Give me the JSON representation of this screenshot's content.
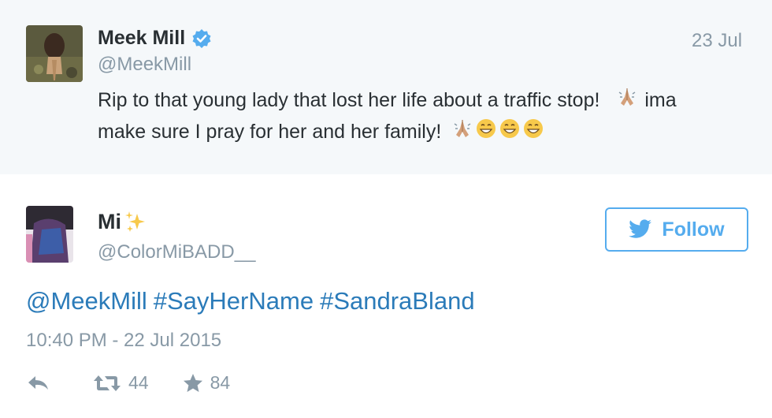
{
  "quoted_tweet": {
    "name": "Meek Mill",
    "handle": "@MeekMill",
    "date": "23 Jul",
    "text_line1": "Rip to that young lady that lost her life about a traffic stop!",
    "text_line1_after": "ima",
    "text_line2": "make sure I pray for her and her family!",
    "verified_icon": "verified-badge-icon",
    "emojis": [
      "folded-hands",
      "folded-hands",
      "grinning-face",
      "grinning-face",
      "grinning-face"
    ]
  },
  "tweet": {
    "name": "Mi",
    "name_emoji": "sparkles",
    "handle": "@ColorMiBADD__",
    "follow_label": "Follow",
    "mention": "@MeekMill",
    "hashtags": [
      "#SayHerName",
      "#SandraBland"
    ],
    "timestamp": "10:40 PM - 22 Jul 2015",
    "retweets": "44",
    "favorites": "84"
  },
  "colors": {
    "link_blue": "#2b7bb9",
    "twitter_blue": "#55acee",
    "muted_gray": "#8899a6",
    "quoted_bg": "#f5f8fa"
  }
}
